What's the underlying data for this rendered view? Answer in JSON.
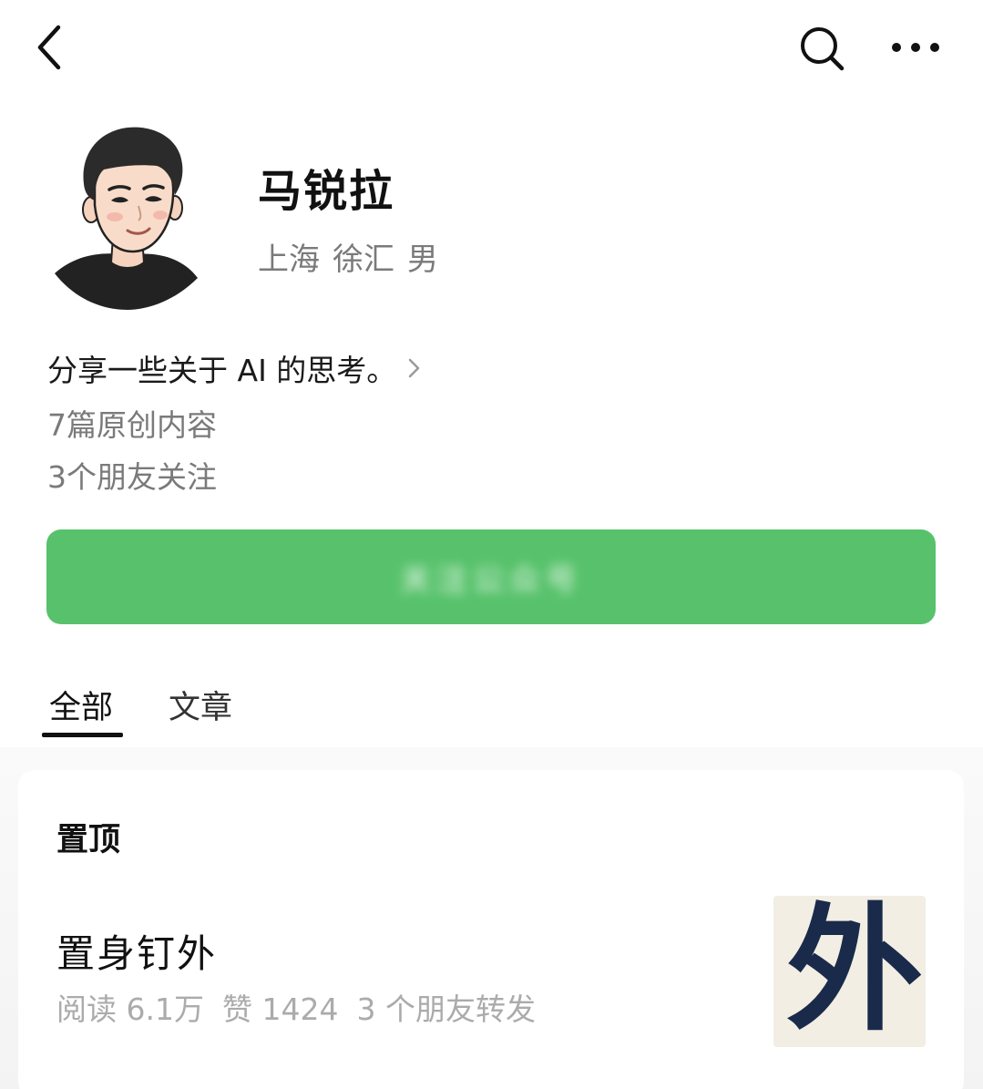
{
  "topbar": {
    "back_icon": "chevron-left-icon",
    "search_icon": "search-icon",
    "more_icon": "more-dots-icon"
  },
  "profile": {
    "avatar_icon": "cartoon-avatar",
    "name": "马锐拉",
    "location": {
      "city": "上海",
      "district": "徐汇",
      "gender": "男"
    },
    "bio": "分享一些关于 AI 的思考。",
    "articles_count": "7篇原创内容",
    "friends_following": "3个朋友关注"
  },
  "follow_button": {
    "label": "关注公众号",
    "color": "#57c26b"
  },
  "tabs": [
    {
      "label": "全部",
      "active": true
    },
    {
      "label": "文章",
      "active": false
    }
  ],
  "pinned": {
    "section_title": "置顶",
    "article": {
      "title": "置身钉外",
      "reads": "阅读 6.1万",
      "likes": "赞 1424",
      "shares": "3 个朋友转发",
      "thumbnail_text": "外"
    }
  }
}
